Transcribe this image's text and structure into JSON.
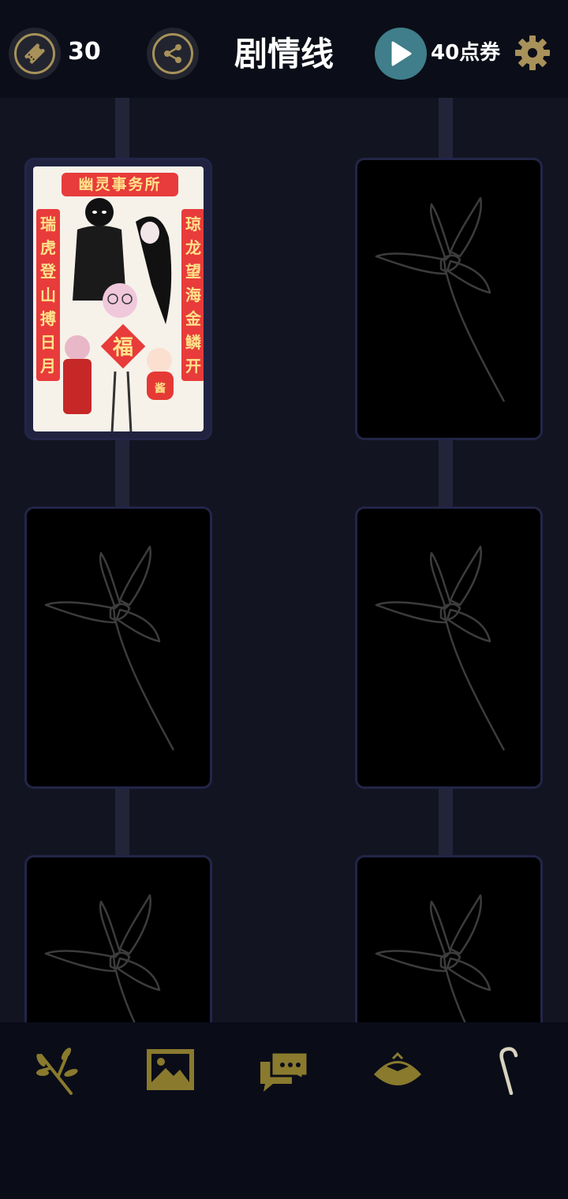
{
  "header": {
    "ticket_count": "30",
    "title": "剧情线",
    "voucher_label": "40点券"
  },
  "poster": {
    "title": "幽灵事务所",
    "couplet_left": "瑞虎登山搏日月",
    "couplet_right": "琼龙望海金鳞开",
    "center_char": "福",
    "badge_char": "酱"
  },
  "icons": {
    "ticket": "ticket-icon",
    "share": "share-icon",
    "play": "play-icon",
    "settings": "gear-icon",
    "nav": [
      "branch-icon",
      "image-icon",
      "chat-icon",
      "hat-icon",
      "cane-icon"
    ]
  },
  "colors": {
    "background": "#121521",
    "topbar": "#0b0e18",
    "gold_accent": "#a8915a",
    "nav_icon": "#8a7a2e",
    "play_button": "#3f7e8a",
    "card_border": "#232548"
  }
}
